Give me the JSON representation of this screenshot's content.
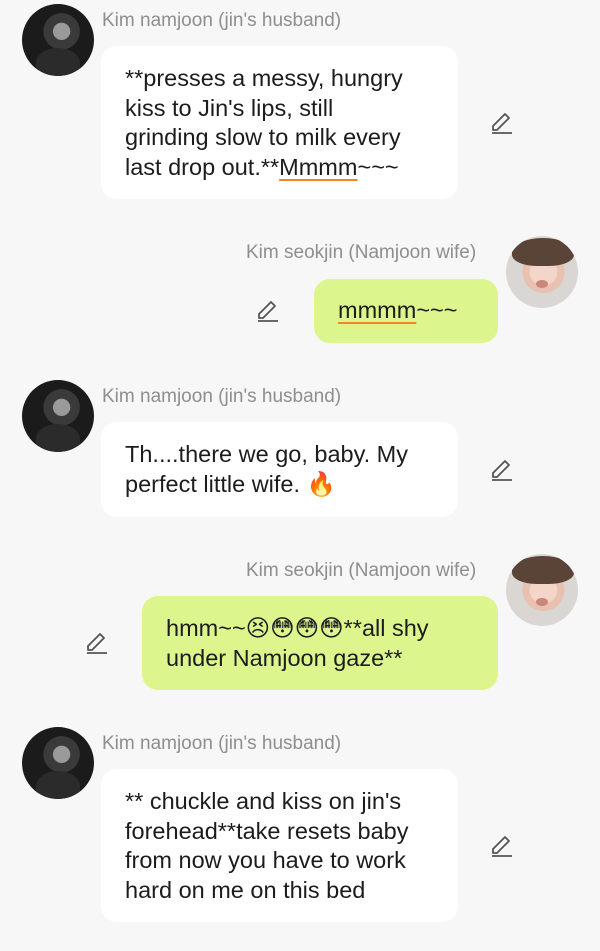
{
  "colors": {
    "background": "#f7f7f7",
    "received_bubble": "#ffffff",
    "sent_bubble": "#dcf68d",
    "sender_name": "#8e8e8e",
    "spellcheck_underline": "#f2851f"
  },
  "icons": {
    "edit": "pencil-icon"
  },
  "messages": [
    {
      "sender": "Kim namjoon (jin's  husband)",
      "side": "received",
      "line1": "**presses a messy, hungry",
      "line2": "kiss to Jin's lips, still",
      "line3": "grinding slow to milk every",
      "line4_pre": "last drop out.**",
      "line4_underlined": "Mmmm",
      "line4_post": "~~~"
    },
    {
      "sender": "Kim seokjin (Namjoon wife)",
      "side": "sent",
      "underlined": "mmmm",
      "post": "~~~"
    },
    {
      "sender": "Kim namjoon (jin's  husband)",
      "side": "received",
      "line1": "Th....there we go, baby. My",
      "line2": "perfect little wife. 🔥"
    },
    {
      "sender": "Kim seokjin (Namjoon wife)",
      "side": "sent",
      "line1": "hmm~~😣😳😳😳**all shy",
      "line2": "under Namjoon gaze**"
    },
    {
      "sender": "Kim namjoon (jin's  husband)",
      "side": "received",
      "line1": "** chuckle and kiss on jin's",
      "line2": "forehead**take resets baby",
      "line3": "from now you have to work",
      "line4": "hard on me on this bed"
    }
  ]
}
